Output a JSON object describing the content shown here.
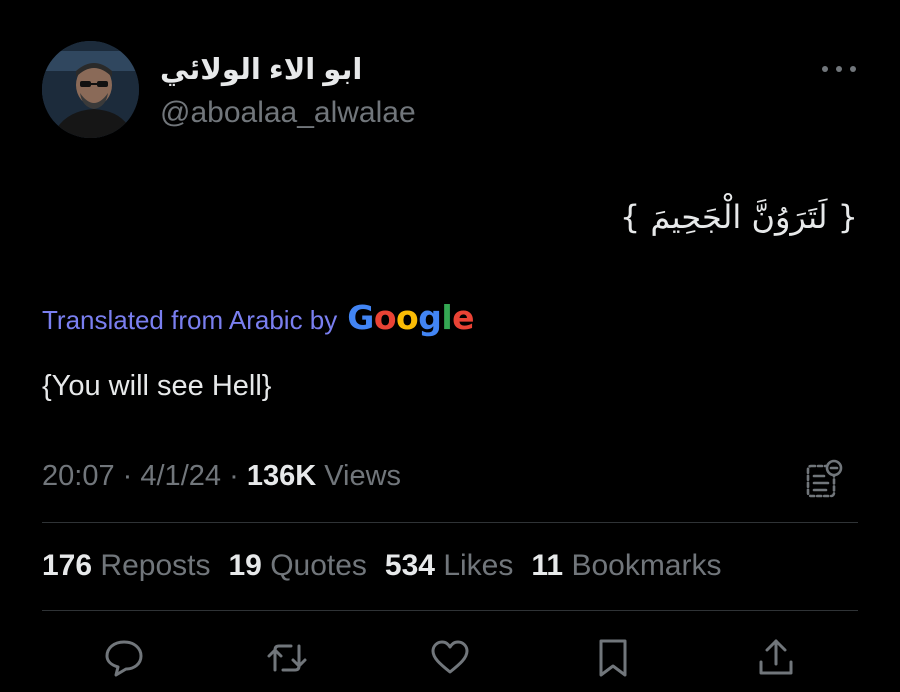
{
  "author": {
    "display_name": "ابو الاء الولائي",
    "handle": "@aboalaa_alwalae",
    "avatar_icon": "user-avatar"
  },
  "tweet": {
    "text": "{ لَتَرَوُنَّ الْجَحِيمَ }",
    "translated_label": "Translated from Arabic by",
    "translator_brand": {
      "letters": [
        "G",
        "o",
        "o",
        "g",
        "l",
        "e"
      ],
      "colors": [
        "#4285F4",
        "#EA4335",
        "#FBBC05",
        "#4285F4",
        "#34A853",
        "#EA4335"
      ]
    },
    "translation": "{You will see Hell}"
  },
  "meta": {
    "time": "20:07",
    "separator": "·",
    "date": "4/1/24",
    "views_count": "136K",
    "views_label": "Views"
  },
  "stats": {
    "reposts": {
      "count": "176",
      "label": "Reposts"
    },
    "quotes": {
      "count": "19",
      "label": "Quotes"
    },
    "likes": {
      "count": "534",
      "label": "Likes"
    },
    "bookmarks": {
      "count": "11",
      "label": "Bookmarks"
    }
  },
  "icons": {
    "more": "more-horizontal-icon",
    "analytics": "analytics-icon",
    "reply": "reply-icon",
    "repost": "repost-icon",
    "like": "like-icon",
    "bookmark": "bookmark-icon",
    "share": "share-icon"
  },
  "colors": {
    "background": "#000000",
    "text_primary": "#e7e9ea",
    "text_secondary": "#71767b",
    "translation_label": "#7a7ff0",
    "divider": "#2f3336"
  }
}
